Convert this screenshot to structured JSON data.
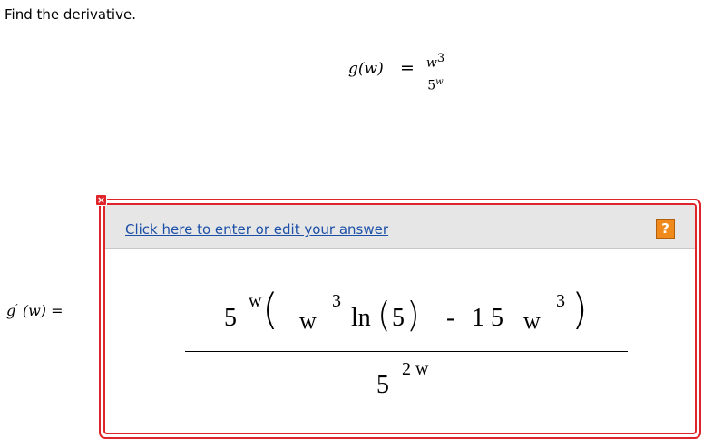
{
  "prompt": "Find the derivative.",
  "problem": {
    "lhs": "g(w)",
    "equals": "=",
    "numerator_base": "w",
    "numerator_exp": "3",
    "denominator_base": "5",
    "denominator_exp": "w"
  },
  "answer_label": {
    "func": "g",
    "prime": "′",
    "arg": "(w)",
    "equals": "="
  },
  "answer_box": {
    "edit_link": "Click here to enter or edit your answer",
    "help_label": "?",
    "close_label": "×"
  },
  "answer_expr": {
    "num": {
      "base5": "5",
      "exp_w": "w",
      "lparen": "(",
      "w1": "w",
      "exp3a": "3",
      "ln": "ln",
      "lparen2": "(",
      "five": "5",
      "rparen2": ")",
      "minus": "-",
      "fifteen": "1 5",
      "w2": "w",
      "exp3b": "3",
      "rparen": ")"
    },
    "den": {
      "base5": "5",
      "exp": "2 w"
    }
  },
  "colors": {
    "border": "#e0242b",
    "link": "#1b4fa8",
    "help": "#f08a1d",
    "header_bg": "#e6e6e6"
  }
}
